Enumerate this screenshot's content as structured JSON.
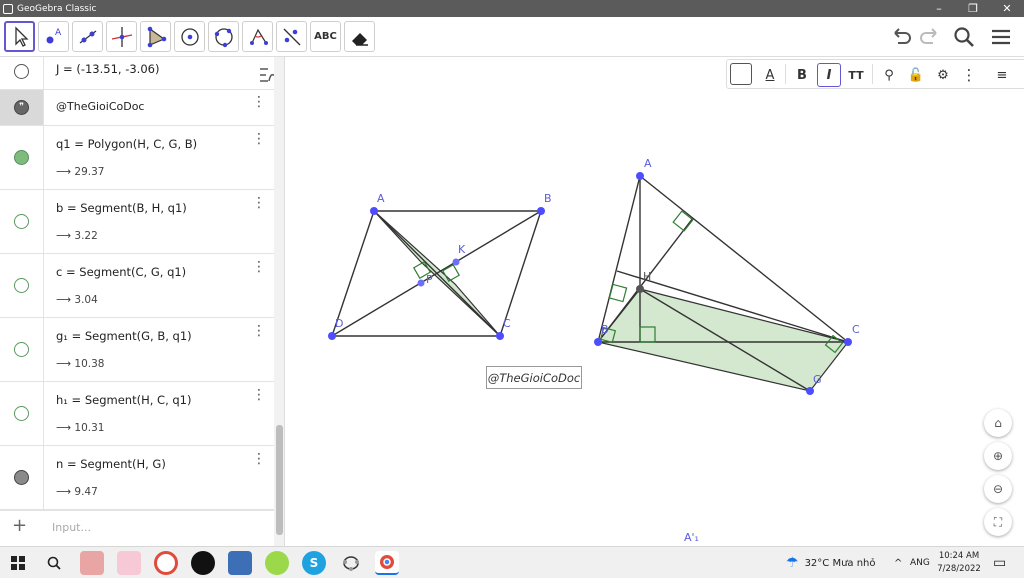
{
  "window": {
    "title": "GeoGebra Classic",
    "controls": [
      "–",
      "❐",
      "✕"
    ]
  },
  "toolbar": {
    "tools": [
      {
        "name": "move-tool",
        "icon": "arrow-cursor-icon"
      },
      {
        "name": "point-tool",
        "icon": "point-icon",
        "label": "A"
      },
      {
        "name": "line-tool",
        "icon": "line-icon"
      },
      {
        "name": "perpendicular-tool",
        "icon": "perpendicular-line-icon"
      },
      {
        "name": "polygon-tool",
        "icon": "polygon-icon"
      },
      {
        "name": "circle-tool",
        "icon": "circle-center-point-icon"
      },
      {
        "name": "circle-three-points-tool",
        "icon": "circle-three-points-icon"
      },
      {
        "name": "angle-tool",
        "icon": "angle-icon"
      },
      {
        "name": "reflect-tool",
        "icon": "reflect-line-icon"
      },
      {
        "name": "text-tool",
        "label": "ABC"
      },
      {
        "name": "eraser-tool",
        "icon": "eraser-icon"
      }
    ],
    "undo_icon": "undo-icon",
    "redo_icon": "redo-icon",
    "search_icon": "search-icon",
    "menu_icon": "hamburger-menu-icon"
  },
  "algebra": {
    "rows": [
      {
        "def": "J = (-13.51, -3.06)",
        "value": "",
        "marble": "hollow"
      },
      {
        "def": "@TheGioiCoDoc",
        "value": "",
        "marble": "quote"
      },
      {
        "def": "q1 = Polygon(H, C, G, B)",
        "value": "⟶ 29.37",
        "marble": "green"
      },
      {
        "def": "b = Segment(B, H, q1)",
        "value": "⟶ 3.22",
        "marble": "hollow-green"
      },
      {
        "def": "c = Segment(C, G, q1)",
        "value": "⟶ 3.04",
        "marble": "hollow-green"
      },
      {
        "def": "g₁ = Segment(G, B, q1)",
        "value": "⟶ 10.38",
        "marble": "hollow-green"
      },
      {
        "def": "h₁ = Segment(H, C, q1)",
        "value": "⟶ 10.31",
        "marble": "hollow-green"
      },
      {
        "def": "n = Segment(H, G)",
        "value": "⟶ 9.47",
        "marble": "gray"
      }
    ],
    "input_placeholder": "Input..."
  },
  "stylebar": {
    "bold": "B",
    "italic": "I",
    "text_size": "TT",
    "text_color_label": "A"
  },
  "graphics": {
    "labels": {
      "A1": "A",
      "B1": "B",
      "C1": "C",
      "D1": "D",
      "K": "K",
      "P": "P",
      "A2": "A",
      "H": "H",
      "B2": "B",
      "C2": "C",
      "G": "G",
      "A_prime": "A'₁"
    },
    "watermark": "@TheGioiCoDoc",
    "colors": {
      "point": "#4d4dff",
      "fill": "#d4e8d0",
      "accent": "#6557d2"
    }
  },
  "taskbar": {
    "weather": "32°C  Mưa nhỏ",
    "lang": "ANG",
    "time": "10:24 AM",
    "date": "7/28/2022"
  }
}
